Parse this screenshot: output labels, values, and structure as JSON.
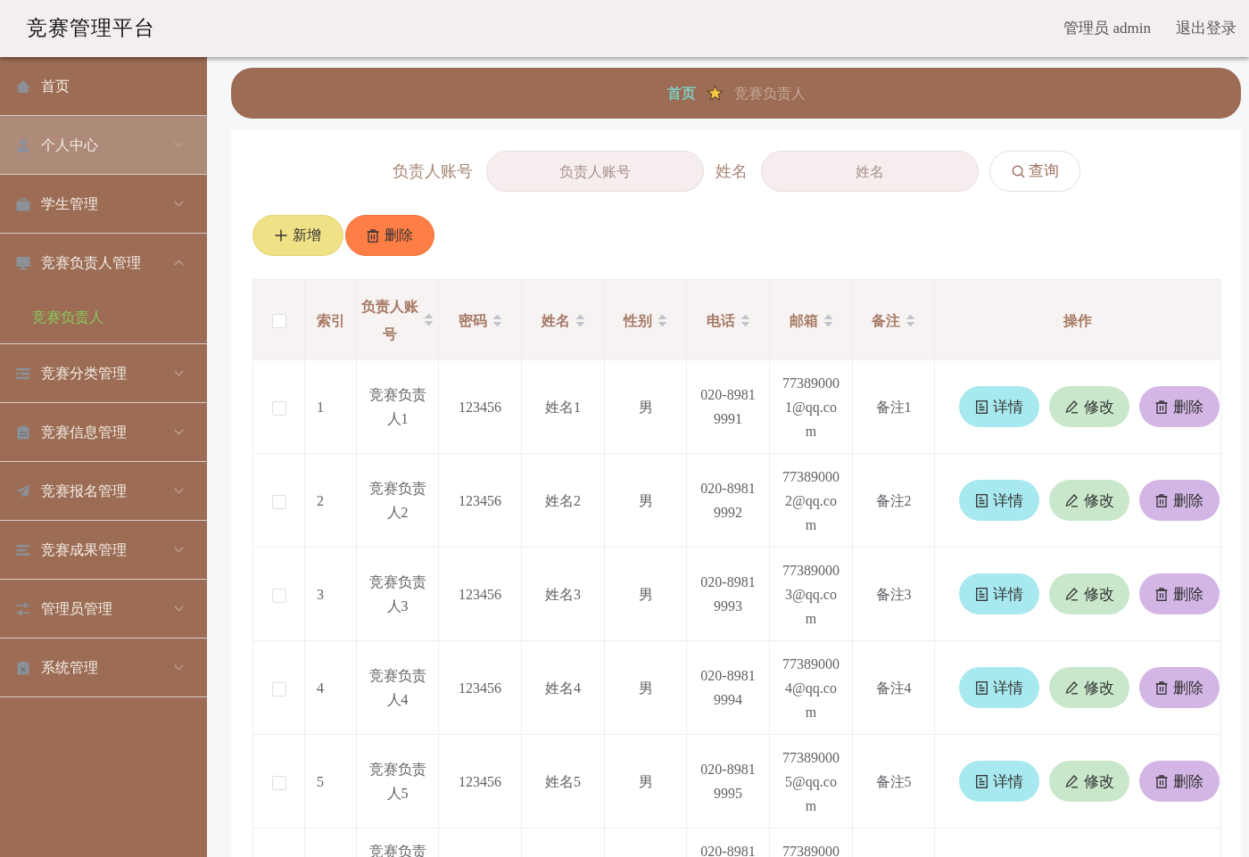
{
  "header": {
    "title": "竞赛管理平台",
    "user": "管理员 admin",
    "logout": "退出登录"
  },
  "sidebar": {
    "items": [
      {
        "label": "首页",
        "highlighted": false
      },
      {
        "label": "个人中心",
        "highlighted": true,
        "expanded": false
      },
      {
        "label": "学生管理",
        "highlighted": false,
        "expanded": false
      },
      {
        "label": "竞赛负责人管理",
        "highlighted": false,
        "expanded": true,
        "children": [
          {
            "label": "竞赛负责人",
            "selected": true
          }
        ]
      },
      {
        "label": "竞赛分类管理",
        "highlighted": false,
        "expanded": false
      },
      {
        "label": "竞赛信息管理",
        "highlighted": false,
        "expanded": false
      },
      {
        "label": "竞赛报名管理",
        "highlighted": false,
        "expanded": false
      },
      {
        "label": "竞赛成果管理",
        "highlighted": false,
        "expanded": false
      },
      {
        "label": "管理员管理",
        "highlighted": false,
        "expanded": false
      },
      {
        "label": "系统管理",
        "highlighted": false,
        "expanded": false
      }
    ]
  },
  "breadcrumb": [
    {
      "label": "首页",
      "current": false
    },
    {
      "label": "竞赛负责人",
      "current": true
    }
  ],
  "search": {
    "fields": [
      {
        "label": "负责人账号",
        "placeholder": "负责人账号"
      },
      {
        "label": "姓名",
        "placeholder": "姓名"
      }
    ],
    "button": "查询"
  },
  "toolbar": [
    {
      "label": "新增",
      "kind": "add"
    },
    {
      "label": "删除",
      "kind": "delete"
    }
  ],
  "table": {
    "select_all_checked": false,
    "columns": [
      {
        "label": "索引",
        "sortable": false
      },
      {
        "label": "负责人账号",
        "sortable": true
      },
      {
        "label": "密码",
        "sortable": true
      },
      {
        "label": "姓名",
        "sortable": true
      },
      {
        "label": "性别",
        "sortable": true
      },
      {
        "label": "电话",
        "sortable": true
      },
      {
        "label": "邮箱",
        "sortable": true
      },
      {
        "label": "备注",
        "sortable": true
      },
      {
        "label": "操作",
        "sortable": false
      }
    ],
    "rows": [
      {
        "checked": false,
        "index": "1",
        "account": "竞赛负责人1",
        "password": "123456",
        "name": "姓名1",
        "gender": "男",
        "phone": "020-89819991",
        "email": "773890001@qq.com",
        "note": "备注1",
        "actions": [
          {
            "label": "详情",
            "kind": "details"
          },
          {
            "label": "修改",
            "kind": "edit"
          },
          {
            "label": "删除",
            "kind": "delete"
          }
        ]
      },
      {
        "checked": false,
        "index": "2",
        "account": "竞赛负责人2",
        "password": "123456",
        "name": "姓名2",
        "gender": "男",
        "phone": "020-89819992",
        "email": "773890002@qq.com",
        "note": "备注2",
        "actions": [
          {
            "label": "详情",
            "kind": "details"
          },
          {
            "label": "修改",
            "kind": "edit"
          },
          {
            "label": "删除",
            "kind": "delete"
          }
        ]
      },
      {
        "checked": false,
        "index": "3",
        "account": "竞赛负责人3",
        "password": "123456",
        "name": "姓名3",
        "gender": "男",
        "phone": "020-89819993",
        "email": "773890003@qq.com",
        "note": "备注3",
        "actions": [
          {
            "label": "详情",
            "kind": "details"
          },
          {
            "label": "修改",
            "kind": "edit"
          },
          {
            "label": "删除",
            "kind": "delete"
          }
        ]
      },
      {
        "checked": false,
        "index": "4",
        "account": "竞赛负责人4",
        "password": "123456",
        "name": "姓名4",
        "gender": "男",
        "phone": "020-89819994",
        "email": "773890004@qq.com",
        "note": "备注4",
        "actions": [
          {
            "label": "详情",
            "kind": "details"
          },
          {
            "label": "修改",
            "kind": "edit"
          },
          {
            "label": "删除",
            "kind": "delete"
          }
        ]
      },
      {
        "checked": false,
        "index": "5",
        "account": "竞赛负责人5",
        "password": "123456",
        "name": "姓名5",
        "gender": "男",
        "phone": "020-89819995",
        "email": "773890005@qq.com",
        "note": "备注5",
        "actions": [
          {
            "label": "详情",
            "kind": "details"
          },
          {
            "label": "修改",
            "kind": "edit"
          },
          {
            "label": "删除",
            "kind": "delete"
          }
        ]
      },
      {
        "account": "竞赛负责",
        "phone": "020-8981",
        "email": "77389000"
      }
    ]
  }
}
